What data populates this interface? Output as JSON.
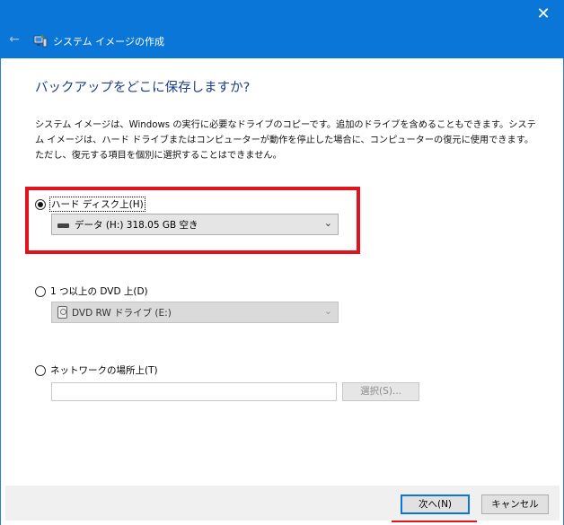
{
  "window": {
    "title": "システム イメージの作成",
    "close_glyph": "✕",
    "back_glyph": "←"
  },
  "main": {
    "heading": "バックアップをどこに保存しますか?",
    "description": "システム イメージは、Windows の実行に必要なドライブのコピーです。追加のドライブを含めることもできます。システム イメージは、ハード ドライブまたはコンピューターが動作を停止した場合に、コンピューターの復元に使用できます。ただし、復元する項目を個別に選択することはできません。"
  },
  "options": {
    "hard_disk": {
      "label": "ハード ディスク上(H)",
      "selected": true,
      "drive_value": "データ (H:)  318.05 GB 空き"
    },
    "dvd": {
      "label": "1 つ以上の DVD 上(D)",
      "selected": false,
      "drive_value": "DVD RW ドライブ (E:)"
    },
    "network": {
      "label": "ネットワークの場所上(T)",
      "selected": false,
      "input_value": "",
      "browse_label": "選択(S)..."
    }
  },
  "footer": {
    "next_label": "次へ(N)",
    "cancel_label": "キャンセル"
  },
  "colors": {
    "titlebar": "#0a77d8",
    "heading": "#1d3e8b",
    "highlight": "#e4121d"
  }
}
